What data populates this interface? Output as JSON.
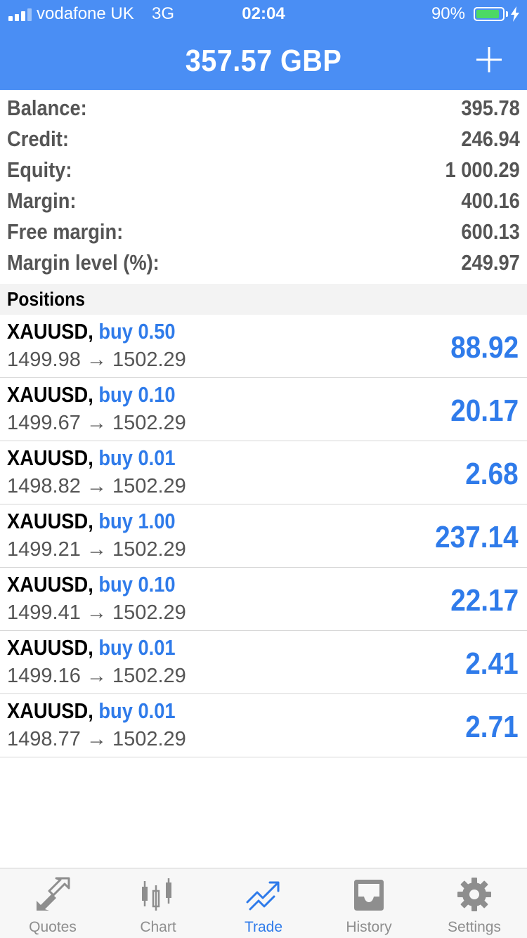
{
  "status": {
    "carrier": "vodafone UK",
    "network": "3G",
    "time": "02:04",
    "battery_pct": "90%",
    "battery_level": 0.9
  },
  "header": {
    "title": "357.57 GBP",
    "add_icon": "plus-icon"
  },
  "summary": [
    {
      "label": "Balance:",
      "value": "395.78"
    },
    {
      "label": "Credit:",
      "value": "246.94"
    },
    {
      "label": "Equity:",
      "value": "1 000.29"
    },
    {
      "label": "Margin:",
      "value": "400.16"
    },
    {
      "label": "Free margin:",
      "value": "600.13"
    },
    {
      "label": "Margin level (%):",
      "value": "249.97"
    }
  ],
  "positions_title": "Positions",
  "positions": [
    {
      "symbol": "XAUUSD,",
      "side": "buy 0.50",
      "prices": "1499.98 → 1502.29",
      "profit": "88.92"
    },
    {
      "symbol": "XAUUSD,",
      "side": "buy 0.10",
      "prices": "1499.67 → 1502.29",
      "profit": "20.17"
    },
    {
      "symbol": "XAUUSD,",
      "side": "buy 0.01",
      "prices": "1498.82 → 1502.29",
      "profit": "2.68"
    },
    {
      "symbol": "XAUUSD,",
      "side": "buy 1.00",
      "prices": "1499.21 → 1502.29",
      "profit": "237.14"
    },
    {
      "symbol": "XAUUSD,",
      "side": "buy 0.10",
      "prices": "1499.41 → 1502.29",
      "profit": "22.17"
    },
    {
      "symbol": "XAUUSD,",
      "side": "buy 0.01",
      "prices": "1499.16 → 1502.29",
      "profit": "2.41"
    },
    {
      "symbol": "XAUUSD,",
      "side": "buy 0.01",
      "prices": "1498.77 → 1502.29",
      "profit": "2.71"
    }
  ],
  "tabs": [
    {
      "label": "Quotes",
      "icon": "quotes-arrows-icon",
      "active": false
    },
    {
      "label": "Chart",
      "icon": "candlestick-chart-icon",
      "active": false
    },
    {
      "label": "Trade",
      "icon": "trade-trend-icon",
      "active": true
    },
    {
      "label": "History",
      "icon": "inbox-tray-icon",
      "active": false
    },
    {
      "label": "Settings",
      "icon": "gear-icon",
      "active": false
    }
  ],
  "colors": {
    "header": "#4a8ef4",
    "accent": "#2f7bea",
    "battery": "#4cd964"
  }
}
